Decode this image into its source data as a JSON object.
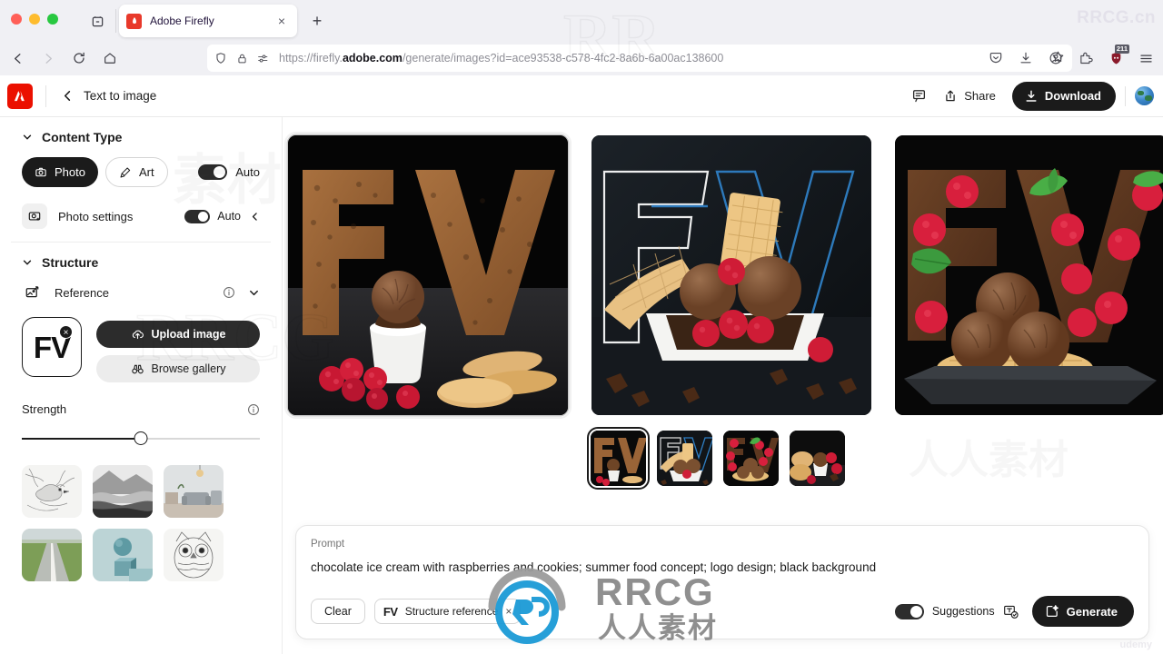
{
  "browser": {
    "tab": {
      "title": "Adobe Firefly",
      "favicon": "adobe-firefly-icon",
      "close": "×"
    },
    "new_tab": "+",
    "nav": {
      "back": "back-arrow-icon",
      "forward": "forward-arrow-icon",
      "reload": "reload-icon",
      "home": "home-icon"
    },
    "url": {
      "scheme": "https://firefly.",
      "domain": "adobe.com",
      "path": "/generate/images?id=ace93538-c578-4fc2-8a6b-6a00ac138600",
      "full": "https://firefly.adobe.com/generate/images?id=ace93538-c578-4fc2-8a6b-6a00ac138600"
    },
    "toolbar_right": {
      "pocket": "pocket-icon",
      "downloads": "download-icon",
      "account": "account-icon",
      "extension": "extension-icon",
      "shield_badge": "211",
      "menu": "hamburger-menu-icon"
    }
  },
  "app_header": {
    "logo": "adobe-logo",
    "back_label": "‹",
    "title": "Text to image",
    "comment_icon": "comment-icon",
    "share_label": "Share",
    "download_label": "Download",
    "avatar": "user-avatar"
  },
  "sidebar": {
    "content_type": {
      "title": "Content Type",
      "options": [
        {
          "label": "Photo",
          "icon": "camera-icon",
          "active": true
        },
        {
          "label": "Art",
          "icon": "brush-icon",
          "active": false
        }
      ],
      "auto_label": "Auto",
      "photo_settings": {
        "label": "Photo settings",
        "icon": "photo-settings-icon",
        "auto_label": "Auto"
      }
    },
    "structure": {
      "title": "Structure",
      "reference": {
        "label": "Reference",
        "icon": "image-reference-icon",
        "info_icon": "info-icon",
        "chevron_icon": "chevron-down-icon",
        "thumbnail_text": "FV",
        "remove_label": "×",
        "upload_label": "Upload image",
        "browse_label": "Browse gallery"
      },
      "strength": {
        "label": "Strength",
        "info_icon": "info-icon",
        "value_percent": 50
      },
      "gallery_items": [
        "sketch-bird",
        "grayscale-landscape",
        "living-room-interior",
        "green-field-road",
        "sphere-on-cube",
        "sketch-owl"
      ]
    }
  },
  "main": {
    "results": [
      {
        "name": "result-1-wafer-fv",
        "selected": true
      },
      {
        "name": "result-2-wireframe-fv",
        "selected": false
      },
      {
        "name": "result-3-chocolate-fv",
        "selected": false
      }
    ],
    "thumbnails": [
      {
        "name": "thumbnail-1",
        "selected": true
      },
      {
        "name": "thumbnail-2",
        "selected": false
      },
      {
        "name": "thumbnail-3",
        "selected": false
      },
      {
        "name": "thumbnail-4",
        "selected": false
      }
    ],
    "cursor": "mouse-pointer"
  },
  "prompt_bar": {
    "label": "Prompt",
    "text": "chocolate ice cream with raspberries and cookies; summer food concept; logo design; black background",
    "clear_label": "Clear",
    "chip": {
      "badge": "FV",
      "label": "Structure reference",
      "remove": "×"
    },
    "suggestions_label": "Suggestions",
    "suggestions_icon": "suggestions-check-icon",
    "generate_label": "Generate"
  },
  "watermarks": {
    "top_right": "RRCG.cn",
    "bottom_right": "udemy",
    "center_brand": "RRCG",
    "center_sub": "人人素材"
  },
  "colors": {
    "accent_dark": "#1b1b1b",
    "adobe_red": "#eb1000",
    "chrome_bg": "#f0f0f4",
    "wireframe_blue": "#2f7fc4"
  }
}
